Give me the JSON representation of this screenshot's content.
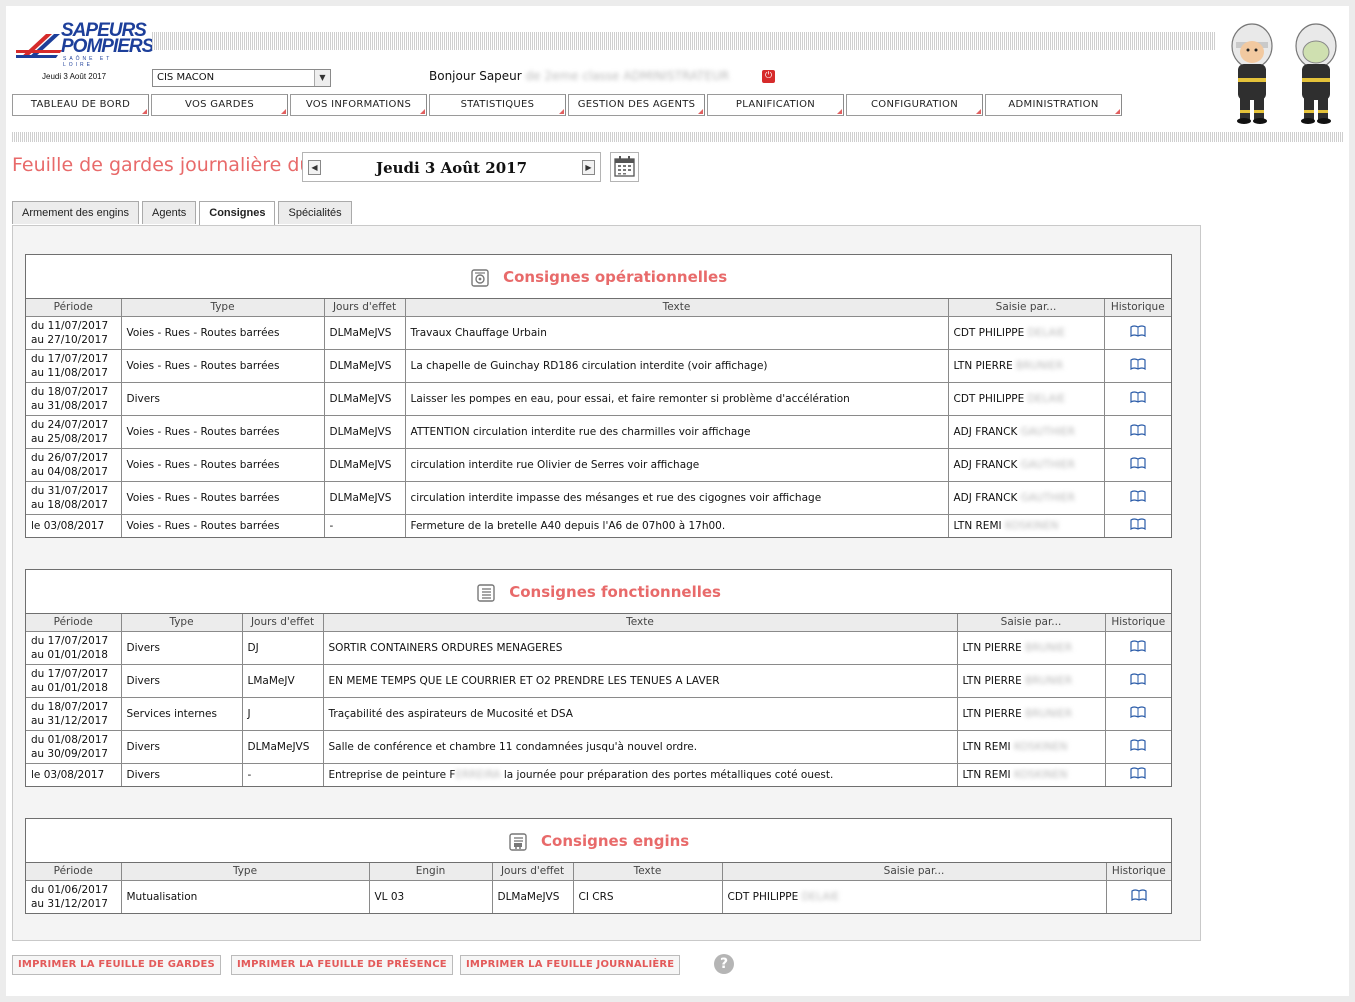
{
  "header": {
    "logo": {
      "line1": "SAPEURS",
      "line2": "POMPIERS",
      "sub": "SAÔNE ET LOIRE"
    },
    "date_small": "Jeudi 3 Août 2017",
    "cis_select": "CIS MACON",
    "greeting": "Bonjour Sapeur",
    "user_blur": "de 2eme classe ADMINISTRATEUR"
  },
  "nav": [
    "TABLEAU DE BORD",
    "VOS GARDES",
    "VOS INFORMATIONS",
    "STATISTIQUES",
    "GESTION DES AGENTS",
    "PLANIFICATION",
    "CONFIGURATION",
    "ADMINISTRATION"
  ],
  "sheet": {
    "title": "Feuille de gardes journalière du :",
    "date": "Jeudi 3 Août 2017"
  },
  "tabs": [
    "Armement des engins",
    "Agents",
    "Consignes",
    "Spécialités"
  ],
  "operational": {
    "title": "Consignes opérationnelles",
    "columns": [
      "Période",
      "Type",
      "Jours d'effet",
      "Texte",
      "Saisie par...",
      "Historique"
    ],
    "rows": [
      {
        "p1": "du 11/07/2017",
        "p2": "au 27/10/2017",
        "type": "Voies - Rues - Routes barrées",
        "jours": "DLMaMeJVS",
        "texte": "Travaux Chauffage Urbain",
        "saisie": "CDT PHILIPPE",
        "saisie_blur": "DELAIE"
      },
      {
        "p1": "du 17/07/2017",
        "p2": "au 11/08/2017",
        "type": "Voies - Rues - Routes barrées",
        "jours": "DLMaMeJVS",
        "texte": "La chapelle de Guinchay RD186 circulation interdite (voir affichage)",
        "saisie": "LTN PIERRE",
        "saisie_blur": "BRUNIER"
      },
      {
        "p1": "du 18/07/2017",
        "p2": "au 31/08/2017",
        "type": "Divers",
        "jours": "DLMaMeJVS",
        "texte": "Laisser les pompes en eau, pour essai, et faire remonter si problème d'accélération",
        "saisie": "CDT PHILIPPE",
        "saisie_blur": "DELAIE"
      },
      {
        "p1": "du 24/07/2017",
        "p2": "au 25/08/2017",
        "type": "Voies - Rues - Routes barrées",
        "jours": "DLMaMeJVS",
        "texte": "ATTENTION circulation interdite rue des charmilles voir affichage",
        "saisie": "ADJ FRANCK",
        "saisie_blur": "GAUTHIER"
      },
      {
        "p1": "du 26/07/2017",
        "p2": "au 04/08/2017",
        "type": "Voies - Rues - Routes barrées",
        "jours": "DLMaMeJVS",
        "texte": "circulation interdite rue Olivier de Serres voir affichage",
        "saisie": "ADJ FRANCK",
        "saisie_blur": "GAUTHIER"
      },
      {
        "p1": "du 31/07/2017",
        "p2": "au 18/08/2017",
        "type": "Voies - Rues - Routes barrées",
        "jours": "DLMaMeJVS",
        "texte": "circulation interdite impasse des mésanges et rue des cigognes voir affichage",
        "saisie": "ADJ FRANCK",
        "saisie_blur": "GAUTHIER"
      },
      {
        "p1": "le 03/08/2017",
        "p2": "",
        "type": "Voies - Rues - Routes barrées",
        "jours": "-",
        "texte": "Fermeture de la bretelle A40 depuis l'A6 de 07h00 à 17h00.",
        "saisie": "LTN REMI",
        "saisie_blur": "KOSKINEN"
      }
    ]
  },
  "functional": {
    "title": "Consignes fonctionnelles",
    "columns": [
      "Période",
      "Type",
      "Jours d'effet",
      "Texte",
      "Saisie par...",
      "Historique"
    ],
    "rows": [
      {
        "p1": "du 17/07/2017",
        "p2": "au 01/01/2018",
        "type": "Divers",
        "jours": "DJ",
        "texte": "SORTIR CONTAINERS ORDURES MENAGERES",
        "saisie": "LTN PIERRE",
        "saisie_blur": "BRUNIER"
      },
      {
        "p1": "du 17/07/2017",
        "p2": "au 01/01/2018",
        "type": "Divers",
        "jours": "LMaMeJV",
        "texte": "EN MEME TEMPS QUE LE COURRIER ET O2 PRENDRE LES TENUES A LAVER",
        "saisie": "LTN PIERRE",
        "saisie_blur": "BRUNIER"
      },
      {
        "p1": "du 18/07/2017",
        "p2": "au 31/12/2017",
        "type": "Services internes",
        "jours": "J",
        "texte": "Traçabilité des aspirateurs de Mucosité et DSA",
        "saisie": "LTN PIERRE",
        "saisie_blur": "BRUNIER"
      },
      {
        "p1": "du 01/08/2017",
        "p2": "au 30/09/2017",
        "type": "Divers",
        "jours": "DLMaMeJVS",
        "texte": "Salle de conférence et chambre 11 condamnées jusqu'à nouvel ordre.",
        "saisie": "LTN REMI",
        "saisie_blur": "KOSKINEN"
      },
      {
        "p1": "le 03/08/2017",
        "p2": "",
        "type": "Divers",
        "jours": "-",
        "texte_a": "Entreprise de peinture F",
        "texte_blur": "ERREIRA",
        "texte_b": " la journée pour préparation des portes métalliques coté ouest.",
        "saisie": "LTN REMI",
        "saisie_blur": "KOSKINEN"
      }
    ]
  },
  "engins": {
    "title": "Consignes engins",
    "columns": [
      "Période",
      "Type",
      "Engin",
      "Jours d'effet",
      "Texte",
      "Saisie par...",
      "Historique"
    ],
    "rows": [
      {
        "p1": "du 01/06/2017",
        "p2": "au 31/12/2017",
        "type": "Mutualisation",
        "engin": "VL 03",
        "jours": "DLMaMeJVS",
        "texte": "CI CRS",
        "saisie": "CDT PHILIPPE",
        "saisie_blur": "DELAIE"
      }
    ]
  },
  "footer": {
    "print_gardes": "IMPRIMER LA FEUILLE DE GARDES",
    "print_presence": "IMPRIMER LA FEUILLE DE PRÉSENCE",
    "print_journaliere": "IMPRIMER LA FEUILLE JOURNALIÈRE",
    "help": "?"
  },
  "colors": {
    "accent": "#e86a6a",
    "brand_blue": "#1d3f9a",
    "brand_red": "#d62b2b"
  }
}
